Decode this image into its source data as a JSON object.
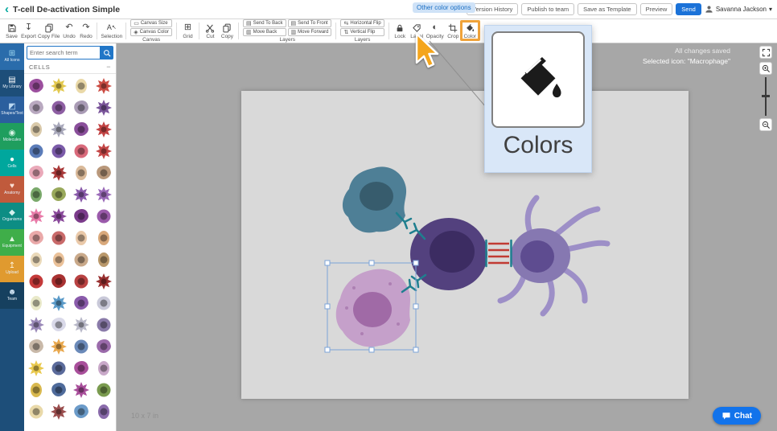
{
  "colors": {
    "brand_teal": "#00a79d",
    "brand_blue": "#1b72d8",
    "highlight_orange": "#f0a33a",
    "sidebar_bg": "#1d4e79",
    "canvas_bg": "#a7a7a7",
    "artboard_bg": "#d9d9d9",
    "popup_bg": "#d9e7f8"
  },
  "icons": {
    "back": "‹",
    "export": "↧",
    "undo": "↶",
    "redo": "↷",
    "grid": "⊞",
    "opacity": "◐",
    "layers_a": "▤",
    "layers_b": "▥",
    "flip_h": "⇆",
    "flip_v": "⇅",
    "canvas_size": "▭",
    "canvas_color": "◈",
    "selection_a": "A",
    "selection_cursor": "↖",
    "caret_down": "▾",
    "collapse": "−"
  },
  "topbar": {
    "title": "T-cell De-activation Simple",
    "tooltip_chip": "Other color options",
    "actions": [
      "Version History",
      "Publish to team",
      "Save as Template",
      "Preview"
    ],
    "send": "Send",
    "user": "Savanna Jackson"
  },
  "toolbar": {
    "left": [
      "Save",
      "Export",
      "Copy File",
      "Undo",
      "Redo"
    ],
    "selection": "Selection",
    "canvas": {
      "buttons": [
        "Canvas Size",
        "Canvas Color"
      ],
      "label": "Canvas"
    },
    "grid": "Grid",
    "cut": "Cut",
    "copy": "Copy",
    "layers": {
      "buttons": [
        "Send To Back",
        "Move Back",
        "Send To Front",
        "Move Forward"
      ],
      "label": "Layers"
    },
    "flip": {
      "buttons": [
        "Horizontal Flip",
        "Vertical Flip"
      ],
      "label": "Layers"
    },
    "right": [
      "Lock",
      "Label",
      "Opacity",
      "Crop",
      "Color"
    ]
  },
  "sidebar": {
    "items": [
      {
        "label": "All Icons",
        "glyph": "⊞",
        "icon_name": "grid-icon",
        "bg": "#2a6cab",
        "icon_color": "#9fd9f0"
      },
      {
        "label": "My Library",
        "glyph": "▤",
        "icon_name": "library-icon",
        "bg": "",
        "icon_color": "#ffffff"
      },
      {
        "label": "Shapes/Text",
        "glyph": "◩",
        "icon_name": "shapes-icon",
        "bg": "#2b5f9e",
        "icon_color": "#bcd9f2"
      },
      {
        "label": "Molecules",
        "glyph": "◉",
        "icon_name": "molecules-icon",
        "bg": "#1f9e5e",
        "icon_color": "#d8f5e5"
      },
      {
        "label": "Cells",
        "glyph": "●",
        "icon_name": "cells-icon",
        "bg": "#00a79d",
        "icon_color": "#ffffff",
        "active": true
      },
      {
        "label": "Anatomy",
        "glyph": "♥",
        "icon_name": "anatomy-icon",
        "bg": "#c05a3c",
        "icon_color": "#fadfd4"
      },
      {
        "label": "Organisms",
        "glyph": "◆",
        "icon_name": "organisms-icon",
        "bg": "#0d8d84",
        "icon_color": "#d4f1ee"
      },
      {
        "label": "Equipment",
        "glyph": "▲",
        "icon_name": "equipment-icon",
        "bg": "#3fae49",
        "icon_color": "#e0f6e1"
      },
      {
        "label": "Upload",
        "glyph": "↥",
        "icon_name": "upload-icon",
        "bg": "#e09a2f",
        "icon_color": "#fff4dc"
      },
      {
        "label": "Team",
        "glyph": "☻",
        "icon_name": "team-icon",
        "bg": "#16405f",
        "icon_color": "#cfe2f2"
      }
    ]
  },
  "search": {
    "placeholder": "Enter search term"
  },
  "panel": {
    "section": "CELLS"
  },
  "library": {
    "thumbnails": [
      {
        "c": "#9c4f9e",
        "s": "blob"
      },
      {
        "c": "#e3c94f",
        "s": "spiky"
      },
      {
        "c": "#ead9a8",
        "s": "egg"
      },
      {
        "c": "#cc4d44",
        "s": "spiky"
      },
      {
        "c": "#b9a9c0",
        "s": "blob"
      },
      {
        "c": "#8e5fa3",
        "s": "round"
      },
      {
        "c": "#a99bb5",
        "s": "blob"
      },
      {
        "c": "#7b569b",
        "s": "spiky"
      },
      {
        "c": "#d9c9a9",
        "s": "egg"
      },
      {
        "c": "#a9a9bb",
        "s": "spiky"
      },
      {
        "c": "#8a4f9b",
        "s": "blob"
      },
      {
        "c": "#c24444",
        "s": "spiky"
      },
      {
        "c": "#5b7cb9",
        "s": "round"
      },
      {
        "c": "#7b5ba9",
        "s": "round"
      },
      {
        "c": "#d96a7b",
        "s": "round"
      },
      {
        "c": "#c44747",
        "s": "spiky"
      },
      {
        "c": "#eaa9b9",
        "s": "blob"
      },
      {
        "c": "#a93a3a",
        "s": "spiky"
      },
      {
        "c": "#d9b999",
        "s": "egg"
      },
      {
        "c": "#b9987b",
        "s": "blob"
      },
      {
        "c": "#7aa96b",
        "s": "egg"
      },
      {
        "c": "#99a95b",
        "s": "blob"
      },
      {
        "c": "#8a5bab",
        "s": "spiky"
      },
      {
        "c": "#9b6bb9",
        "s": "spiky"
      },
      {
        "c": "#e97ba9",
        "s": "spiky"
      },
      {
        "c": "#8a4a9b",
        "s": "spiky"
      },
      {
        "c": "#7b3b8b",
        "s": "blob"
      },
      {
        "c": "#9b5bab",
        "s": "round"
      },
      {
        "c": "#eaa9a9",
        "s": "blob"
      },
      {
        "c": "#c96a6a",
        "s": "round"
      },
      {
        "c": "#eac9a9",
        "s": "egg"
      },
      {
        "c": "#d9a97b",
        "s": "egg"
      },
      {
        "c": "#ead9b9",
        "s": "egg"
      },
      {
        "c": "#eac199",
        "s": "egg"
      },
      {
        "c": "#c9a98a",
        "s": "round"
      },
      {
        "c": "#b9986b",
        "s": "egg"
      },
      {
        "c": "#c43a3a",
        "s": "round"
      },
      {
        "c": "#a93232",
        "s": "blob"
      },
      {
        "c": "#b94242",
        "s": "round"
      },
      {
        "c": "#993131",
        "s": "spiky"
      },
      {
        "c": "#e9e9c9",
        "s": "egg"
      },
      {
        "c": "#5b9bc9",
        "s": "spiky"
      },
      {
        "c": "#8a5bab",
        "s": "blob"
      },
      {
        "c": "#c9c9d9",
        "s": "round"
      },
      {
        "c": "#9b8ab9",
        "s": "spiky"
      },
      {
        "c": "#d9d9e9",
        "s": "blob"
      },
      {
        "c": "#b9b9c9",
        "s": "spiky"
      },
      {
        "c": "#8a7ba9",
        "s": "round"
      },
      {
        "c": "#c9b9a9",
        "s": "blob"
      },
      {
        "c": "#e9a94f",
        "s": "spiky"
      },
      {
        "c": "#6b8ab9",
        "s": "round"
      },
      {
        "c": "#9b6bab",
        "s": "blob"
      },
      {
        "c": "#e9c94f",
        "s": "spiky"
      },
      {
        "c": "#5b6b9b",
        "s": "round"
      },
      {
        "c": "#a94f9b",
        "s": "blob"
      },
      {
        "c": "#c9a9c9",
        "s": "egg"
      },
      {
        "c": "#d9b94f",
        "s": "egg"
      },
      {
        "c": "#4f6b9b",
        "s": "blob"
      },
      {
        "c": "#a94f9b",
        "s": "spiky"
      },
      {
        "c": "#7a9b4f",
        "s": "round"
      },
      {
        "c": "#e9d9a9",
        "s": "round"
      },
      {
        "c": "#9b4f4f",
        "s": "spiky"
      },
      {
        "c": "#6b9bc9",
        "s": "blob"
      },
      {
        "c": "#8a6bab",
        "s": "egg"
      }
    ]
  },
  "canvas": {
    "size_label": "10 x 7 in",
    "status_saved": "All changes saved",
    "status_selected": "Selected icon: \"Macrophage\"",
    "chat": "Chat"
  },
  "popup": {
    "label": "Colors"
  },
  "illustration": {
    "cells": [
      {
        "name": "macrophage-teal",
        "body": "#4e7f96",
        "nucleus": "#375c6d"
      },
      {
        "name": "t-cell",
        "body": "#53417e",
        "nucleus": "#3c2c62"
      },
      {
        "name": "dendritic-cell",
        "body": "#8678b1",
        "nucleus": "#5e4c90",
        "tentacle": "#9d8fc7"
      },
      {
        "name": "macrophage-selected",
        "body": "#c5a0ca",
        "nucleus": "#a06aa6",
        "spots": "#ad7fb3"
      }
    ],
    "receptor_color": "#1f7f8f",
    "mhc_color": "#c13b33",
    "selection_color": "#7ba3d8"
  }
}
